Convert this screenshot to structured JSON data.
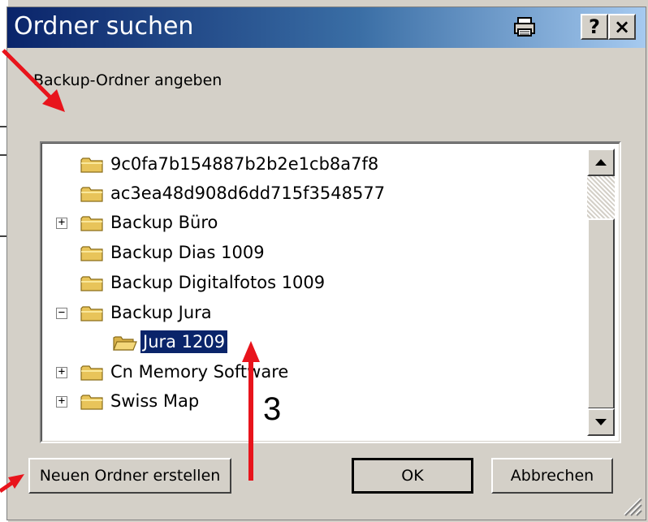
{
  "dialog": {
    "title": "Ordner suchen",
    "prompt": "Backup-Ordner angeben",
    "title_buttons": {
      "help": "?",
      "close": "×"
    }
  },
  "tree": {
    "items": [
      {
        "label": "9c0fa7b154887b2b2e1cb8a7f8",
        "expander": "",
        "indent": 0
      },
      {
        "label": "ac3ea48d908d6dd715f3548577",
        "expander": "",
        "indent": 0
      },
      {
        "label": "Backup Büro",
        "expander": "+",
        "indent": 0
      },
      {
        "label": "Backup Dias 1009",
        "expander": "",
        "indent": 0
      },
      {
        "label": "Backup Digitalfotos 1009",
        "expander": "",
        "indent": 0
      },
      {
        "label": "Backup Jura",
        "expander": "−",
        "indent": 0
      },
      {
        "label": "Jura 1209",
        "expander": "",
        "indent": 1,
        "selected": true
      },
      {
        "label": "Cn Memory Software",
        "expander": "+",
        "indent": 0
      },
      {
        "label": "Swiss Map",
        "expander": "+",
        "indent": 0
      }
    ]
  },
  "buttons": {
    "new_folder": "Neuen Ordner erstellen",
    "ok": "OK",
    "cancel": "Abbrechen"
  },
  "annotation": {
    "number": "3",
    "arrow_color": "#e8141c"
  },
  "colors": {
    "title_start": "#0a246a",
    "title_end": "#a6caf0",
    "selection": "#0a246a",
    "face": "#d4d0c8"
  }
}
